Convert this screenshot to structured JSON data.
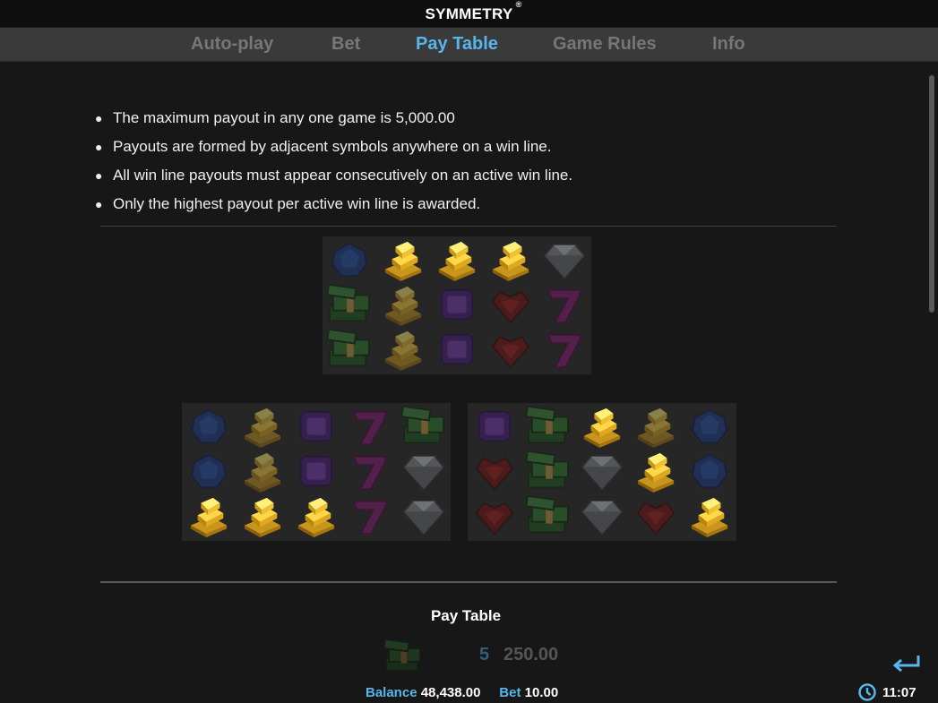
{
  "app": {
    "title": "SYMMETRY",
    "trademark": "®"
  },
  "tabs": [
    {
      "label": "Auto-play",
      "active": false
    },
    {
      "label": "Bet",
      "active": false
    },
    {
      "label": "Pay Table",
      "active": true
    },
    {
      "label": "Game Rules",
      "active": false
    },
    {
      "label": "Info",
      "active": false
    }
  ],
  "rules": [
    "The maximum payout in any one game is 5,000.00",
    "Payouts are formed by adjacent symbols anywhere on a win line.",
    "All win line payouts must appear consecutively on an active win line.",
    "Only the highest payout per active win line is awarded."
  ],
  "examples": [
    {
      "rows": [
        [
          {
            "s": "sapphire",
            "hi": false
          },
          {
            "s": "gold",
            "hi": true
          },
          {
            "s": "gold",
            "hi": true
          },
          {
            "s": "gold",
            "hi": true
          },
          {
            "s": "diamond",
            "hi": false
          }
        ],
        [
          {
            "s": "cash",
            "hi": false
          },
          {
            "s": "gold",
            "hi": false
          },
          {
            "s": "amethyst",
            "hi": false
          },
          {
            "s": "ruby",
            "hi": false
          },
          {
            "s": "seven",
            "hi": false
          }
        ],
        [
          {
            "s": "cash",
            "hi": false
          },
          {
            "s": "gold",
            "hi": false
          },
          {
            "s": "amethyst",
            "hi": false
          },
          {
            "s": "ruby",
            "hi": false
          },
          {
            "s": "seven",
            "hi": false
          }
        ]
      ]
    },
    {
      "rows": [
        [
          {
            "s": "sapphire",
            "hi": false
          },
          {
            "s": "gold",
            "hi": false
          },
          {
            "s": "amethyst",
            "hi": false
          },
          {
            "s": "seven",
            "hi": false
          },
          {
            "s": "cash",
            "hi": false
          }
        ],
        [
          {
            "s": "sapphire",
            "hi": false
          },
          {
            "s": "gold",
            "hi": false
          },
          {
            "s": "amethyst",
            "hi": false
          },
          {
            "s": "seven",
            "hi": false
          },
          {
            "s": "diamond",
            "hi": false
          }
        ],
        [
          {
            "s": "gold",
            "hi": true
          },
          {
            "s": "gold",
            "hi": true
          },
          {
            "s": "gold",
            "hi": true
          },
          {
            "s": "seven",
            "hi": false
          },
          {
            "s": "diamond",
            "hi": false
          }
        ]
      ]
    },
    {
      "rows": [
        [
          {
            "s": "amethyst",
            "hi": false
          },
          {
            "s": "cash",
            "hi": false
          },
          {
            "s": "gold",
            "hi": true
          },
          {
            "s": "gold",
            "hi": false
          },
          {
            "s": "sapphire",
            "hi": false
          }
        ],
        [
          {
            "s": "ruby",
            "hi": false
          },
          {
            "s": "cash",
            "hi": false
          },
          {
            "s": "diamond",
            "hi": false
          },
          {
            "s": "gold",
            "hi": true
          },
          {
            "s": "sapphire",
            "hi": false
          }
        ],
        [
          {
            "s": "ruby",
            "hi": false
          },
          {
            "s": "cash",
            "hi": false
          },
          {
            "s": "diamond",
            "hi": false
          },
          {
            "s": "ruby",
            "hi": false
          },
          {
            "s": "gold",
            "hi": true
          }
        ]
      ]
    }
  ],
  "paytable": {
    "title": "Pay Table",
    "rows": [
      {
        "symbol": "cash",
        "count": "5",
        "value": "250.00"
      }
    ]
  },
  "footer": {
    "balance_label": "Balance",
    "balance_value": "48,438.00",
    "bet_label": "Bet",
    "bet_value": "10.00",
    "time": "11:07"
  },
  "icons": {
    "back": "return-arrow-icon",
    "clock": "clock-icon"
  },
  "colors": {
    "accent": "#58b6ec",
    "background": "#171717",
    "tab_bar": "#3a3a3a"
  }
}
